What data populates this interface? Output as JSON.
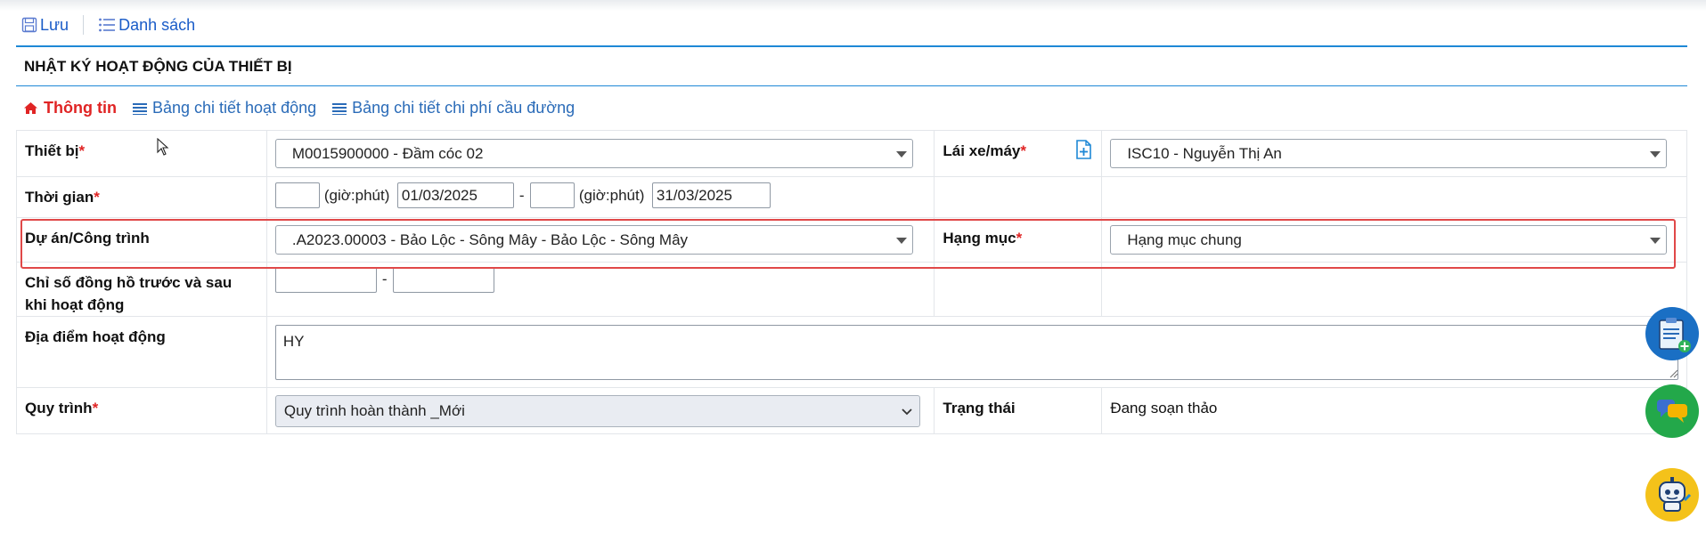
{
  "toolbar": {
    "save_label": "Lưu",
    "list_label": "Danh sách"
  },
  "page_title": "NHẬT KÝ HOẠT ĐỘNG CỦA THIẾT BỊ",
  "tabs": [
    {
      "label": "Thông tin",
      "icon": "home-icon",
      "active": true
    },
    {
      "label": "Bảng chi tiết hoạt động",
      "icon": "list-icon",
      "active": false
    },
    {
      "label": "Bảng chi tiết chi phí cầu đường",
      "icon": "list-icon",
      "active": false
    }
  ],
  "form": {
    "device": {
      "label": "Thiết bị",
      "required": "*",
      "value": "M0015900000 - Đầm cóc 02"
    },
    "driver": {
      "label": "Lái xe/máy",
      "required": "*",
      "value": "ISC10 - Nguyễn Thị An"
    },
    "time": {
      "label": "Thời gian",
      "required": "*",
      "start_time": "",
      "unit1": "(giờ:phút)",
      "start_date": "01/03/2025",
      "separator": "-",
      "end_time": "",
      "unit2": "(giờ:phút)",
      "end_date": "31/03/2025"
    },
    "project": {
      "label": "Dự án/Công trình",
      "value": ".A2023.00003 - Bảo Lộc - Sông Mây - Bảo Lộc - Sông Mây"
    },
    "item": {
      "label": "Hạng mục",
      "required": "*",
      "value": "Hạng mục chung"
    },
    "meter": {
      "label_line1": "Chỉ số đồng hồ trước và sau",
      "label_line2": "khi hoạt động",
      "before": "",
      "separator": "-",
      "after": ""
    },
    "location": {
      "label": "Địa điểm hoạt động",
      "value": "HY"
    },
    "workflow": {
      "label": "Quy trình",
      "required": "*",
      "value": "Quy trình hoàn thành _Mới"
    },
    "status": {
      "label": "Trạng thái",
      "value": "Đang soạn thảo"
    }
  },
  "colors": {
    "accent": "#1e88d6",
    "required": "#e02424",
    "link": "#1a5cc8",
    "highlight": "#e04848"
  }
}
